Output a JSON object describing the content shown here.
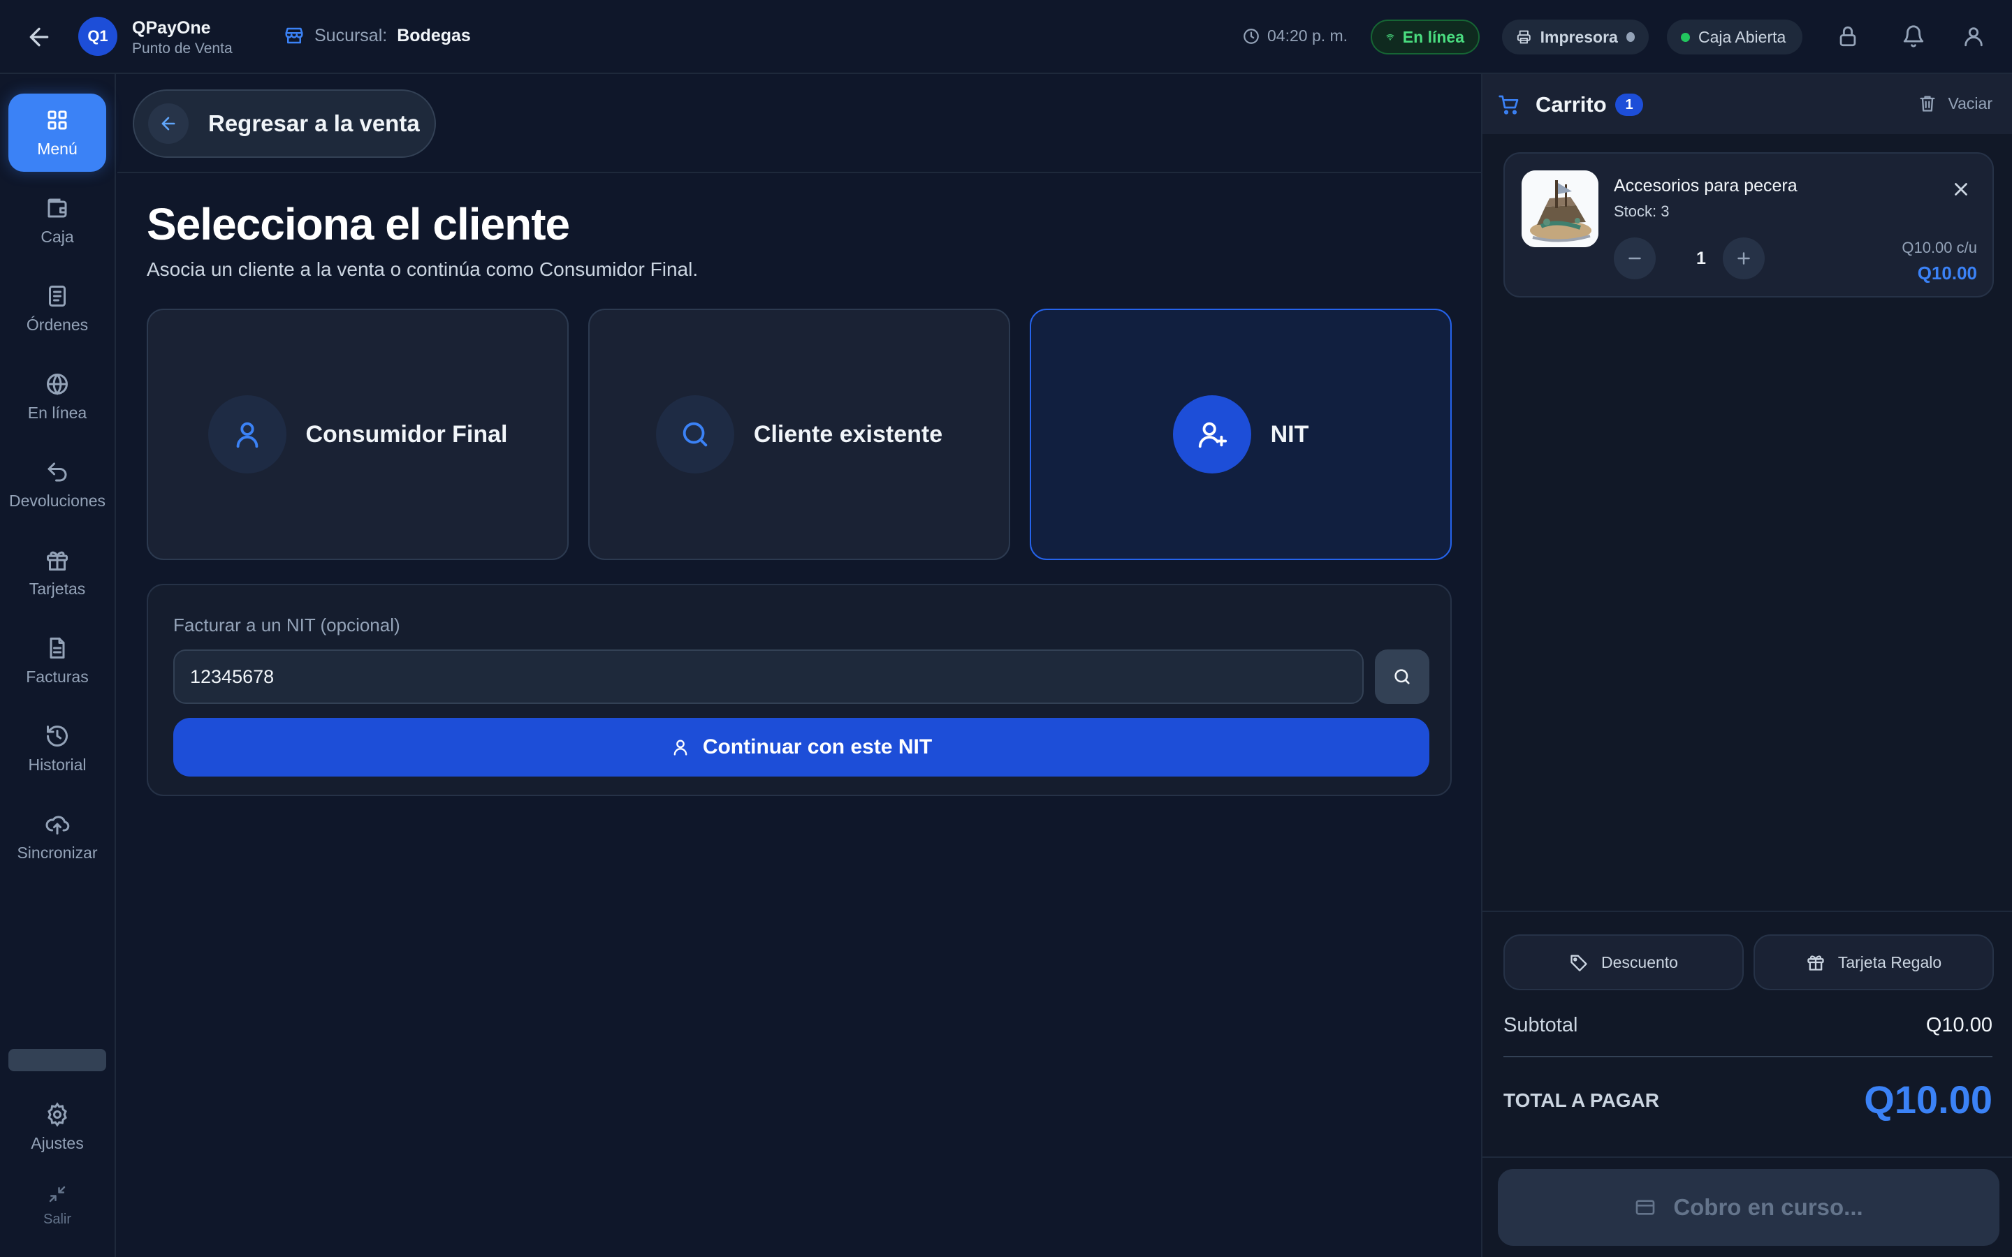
{
  "app": {
    "logo_text": "Q1",
    "name": "QPayOne",
    "subtitle": "Punto de Venta"
  },
  "branch": {
    "prefix": "Sucursal:",
    "name": "Bodegas"
  },
  "status": {
    "time": "04:20 p. m.",
    "online": "En línea",
    "printer": "Impresora",
    "cash": "Caja Abierta"
  },
  "sidebar": {
    "items": [
      {
        "label": "Menú",
        "icon": "grid-icon",
        "active": true
      },
      {
        "label": "Caja",
        "icon": "wallet-icon"
      },
      {
        "label": "Órdenes",
        "icon": "receipt-icon"
      },
      {
        "label": "En línea",
        "icon": "globe-icon"
      },
      {
        "label": "Devoluciones",
        "icon": "undo-icon"
      },
      {
        "label": "Tarjetas",
        "icon": "gift-icon"
      },
      {
        "label": "Facturas",
        "icon": "document-icon"
      },
      {
        "label": "Historial",
        "icon": "history-icon"
      },
      {
        "label": "Sincronizar",
        "icon": "cloud-upload-icon"
      }
    ],
    "settings": "Ajustes",
    "exit": "Salir"
  },
  "main": {
    "return_label": "Regresar a la venta",
    "title": "Selecciona el cliente",
    "description": "Asocia un cliente a la venta o continúa como Consumidor Final.",
    "options": [
      {
        "label": "Consumidor Final",
        "icon": "user-icon"
      },
      {
        "label": "Cliente existente",
        "icon": "search-icon"
      },
      {
        "label": "NIT",
        "icon": "user-plus-icon",
        "selected": true
      }
    ],
    "nit": {
      "label": "Facturar a un NIT (opcional)",
      "value": "12345678",
      "continue_label": "Continuar con este NIT"
    }
  },
  "cart": {
    "title": "Carrito",
    "count": "1",
    "clear_label": "Vaciar",
    "items": [
      {
        "name": "Accesorios para pecera",
        "stock": "Stock: 3",
        "qty": "1",
        "unit_price": "Q10.00 c/u",
        "total": "Q10.00"
      }
    ],
    "discount_label": "Descuento",
    "gift_label": "Tarjeta Regalo",
    "subtotal_label": "Subtotal",
    "subtotal_value": "Q10.00",
    "total_label": "TOTAL A PAGAR",
    "total_value": "Q10.00",
    "pay_label": "Cobro en curso..."
  },
  "colors": {
    "accent": "#3b82f6",
    "primary": "#1d4ed8",
    "success": "#4ade80",
    "background": "#0f172a"
  }
}
